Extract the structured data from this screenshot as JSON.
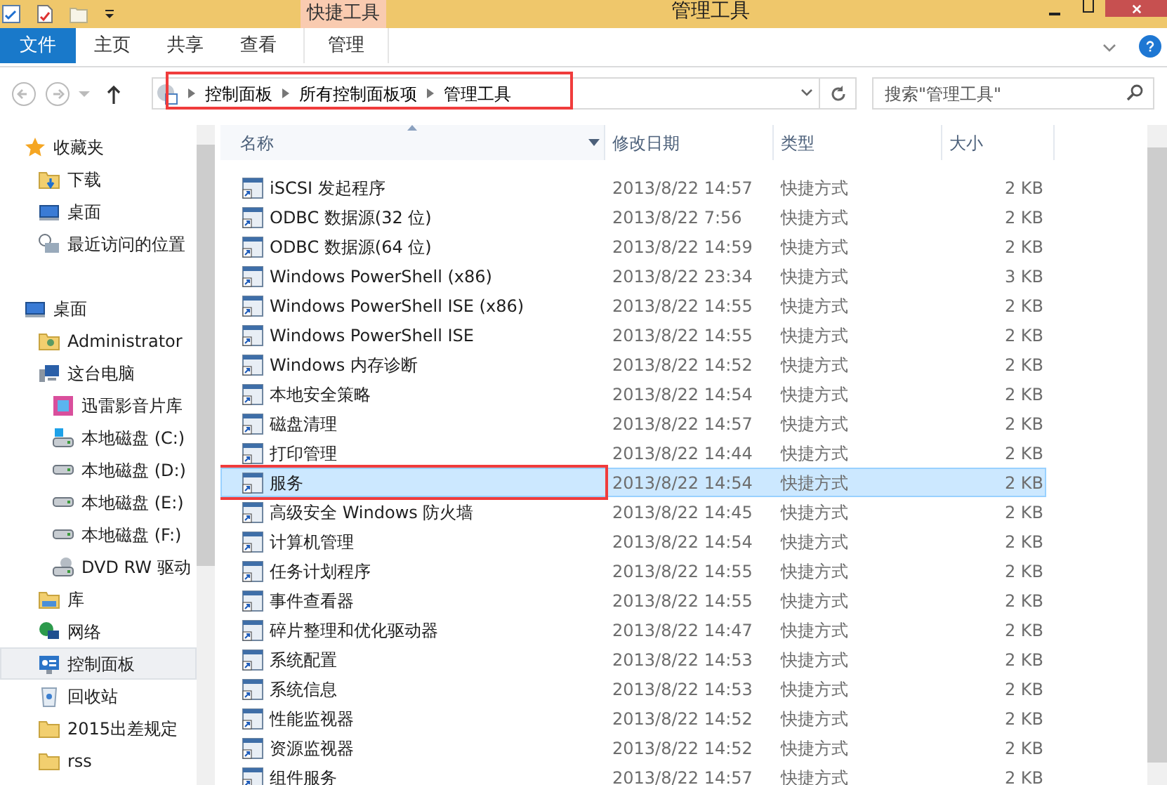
{
  "window": {
    "title": "管理工具",
    "context_group": "快捷工具"
  },
  "quick_access": [
    {
      "kind": "props"
    },
    {
      "kind": "newdoc"
    },
    {
      "kind": "folder"
    },
    {
      "kind": "caret"
    }
  ],
  "ribbon_tabs": [
    {
      "label": "文件",
      "kind": "file"
    },
    {
      "label": "主页",
      "kind": "tab"
    },
    {
      "label": "共享",
      "kind": "tab"
    },
    {
      "label": "查看",
      "kind": "tab"
    },
    {
      "label": "管理",
      "kind": "context"
    }
  ],
  "address": {
    "crumbs": [
      "控制面板",
      "所有控制面板项",
      "管理工具"
    ],
    "highlighted": true
  },
  "search": {
    "placeholder": "搜索\"管理工具\""
  },
  "sidebar": [
    {
      "label": "收藏夹",
      "kind": "star",
      "selected": false,
      "children": [
        {
          "label": "下载",
          "kind": "download",
          "selected": false
        },
        {
          "label": "桌面",
          "kind": "monitor",
          "selected": false
        },
        {
          "label": "最近访问的位置",
          "kind": "recent",
          "selected": false
        }
      ]
    },
    {
      "label": "桌面",
      "kind": "monitor",
      "selected": false,
      "children": [
        {
          "label": "Administrator",
          "kind": "user",
          "selected": false
        },
        {
          "label": "这台电脑",
          "kind": "computer",
          "selected": false,
          "children": [
            {
              "label": "迅雷影音片库",
              "kind": "media",
              "selected": false
            },
            {
              "label": "本地磁盘 (C:)",
              "kind": "sysdrive",
              "selected": false
            },
            {
              "label": "本地磁盘 (D:)",
              "kind": "drive",
              "selected": false
            },
            {
              "label": "本地磁盘 (E:)",
              "kind": "drive",
              "selected": false
            },
            {
              "label": "本地磁盘 (F:)",
              "kind": "drive",
              "selected": false
            },
            {
              "label": "DVD RW 驱动",
              "kind": "dvd",
              "selected": false
            }
          ]
        },
        {
          "label": "库",
          "kind": "library",
          "selected": false
        },
        {
          "label": "网络",
          "kind": "network",
          "selected": false
        },
        {
          "label": "控制面板",
          "kind": "control",
          "selected": true
        },
        {
          "label": "回收站",
          "kind": "recycle",
          "selected": false
        },
        {
          "label": "2015出差规定",
          "kind": "folder",
          "selected": false
        },
        {
          "label": "rss",
          "kind": "folder",
          "selected": false
        }
      ]
    }
  ],
  "table": {
    "columns": [
      "名称",
      "修改日期",
      "类型",
      "大小"
    ],
    "rows": [
      {
        "name": "iSCSI 发起程序",
        "date": "2013/8/22 14:57",
        "type": "快捷方式",
        "size": "2 KB",
        "selected": false,
        "highlighted": false
      },
      {
        "name": "ODBC 数据源(32 位)",
        "date": "2013/8/22 7:56",
        "type": "快捷方式",
        "size": "2 KB",
        "selected": false,
        "highlighted": false
      },
      {
        "name": "ODBC 数据源(64 位)",
        "date": "2013/8/22 14:59",
        "type": "快捷方式",
        "size": "2 KB",
        "selected": false,
        "highlighted": false
      },
      {
        "name": "Windows PowerShell (x86)",
        "date": "2013/8/22 23:34",
        "type": "快捷方式",
        "size": "3 KB",
        "selected": false,
        "highlighted": false
      },
      {
        "name": "Windows PowerShell ISE (x86)",
        "date": "2013/8/22 14:55",
        "type": "快捷方式",
        "size": "2 KB",
        "selected": false,
        "highlighted": false
      },
      {
        "name": "Windows PowerShell ISE",
        "date": "2013/8/22 14:55",
        "type": "快捷方式",
        "size": "2 KB",
        "selected": false,
        "highlighted": false
      },
      {
        "name": "Windows 内存诊断",
        "date": "2013/8/22 14:52",
        "type": "快捷方式",
        "size": "2 KB",
        "selected": false,
        "highlighted": false
      },
      {
        "name": "本地安全策略",
        "date": "2013/8/22 14:54",
        "type": "快捷方式",
        "size": "2 KB",
        "selected": false,
        "highlighted": false
      },
      {
        "name": "磁盘清理",
        "date": "2013/8/22 14:57",
        "type": "快捷方式",
        "size": "2 KB",
        "selected": false,
        "highlighted": false
      },
      {
        "name": "打印管理",
        "date": "2013/8/22 14:44",
        "type": "快捷方式",
        "size": "2 KB",
        "selected": false,
        "highlighted": false
      },
      {
        "name": "服务",
        "date": "2013/8/22 14:54",
        "type": "快捷方式",
        "size": "2 KB",
        "selected": true,
        "highlighted": true
      },
      {
        "name": "高级安全 Windows 防火墙",
        "date": "2013/8/22 14:45",
        "type": "快捷方式",
        "size": "2 KB",
        "selected": false,
        "highlighted": false
      },
      {
        "name": "计算机管理",
        "date": "2013/8/22 14:54",
        "type": "快捷方式",
        "size": "2 KB",
        "selected": false,
        "highlighted": false
      },
      {
        "name": "任务计划程序",
        "date": "2013/8/22 14:55",
        "type": "快捷方式",
        "size": "2 KB",
        "selected": false,
        "highlighted": false
      },
      {
        "name": "事件查看器",
        "date": "2013/8/22 14:55",
        "type": "快捷方式",
        "size": "2 KB",
        "selected": false,
        "highlighted": false
      },
      {
        "name": "碎片整理和优化驱动器",
        "date": "2013/8/22 14:47",
        "type": "快捷方式",
        "size": "2 KB",
        "selected": false,
        "highlighted": false
      },
      {
        "name": "系统配置",
        "date": "2013/8/22 14:53",
        "type": "快捷方式",
        "size": "2 KB",
        "selected": false,
        "highlighted": false
      },
      {
        "name": "系统信息",
        "date": "2013/8/22 14:53",
        "type": "快捷方式",
        "size": "2 KB",
        "selected": false,
        "highlighted": false
      },
      {
        "name": "性能监视器",
        "date": "2013/8/22 14:52",
        "type": "快捷方式",
        "size": "2 KB",
        "selected": false,
        "highlighted": false
      },
      {
        "name": "资源监视器",
        "date": "2013/8/22 14:52",
        "type": "快捷方式",
        "size": "2 KB",
        "selected": false,
        "highlighted": false
      },
      {
        "name": "组件服务",
        "date": "2013/8/22 14:57",
        "type": "快捷方式",
        "size": "2 KB",
        "selected": false,
        "highlighted": false
      }
    ]
  }
}
